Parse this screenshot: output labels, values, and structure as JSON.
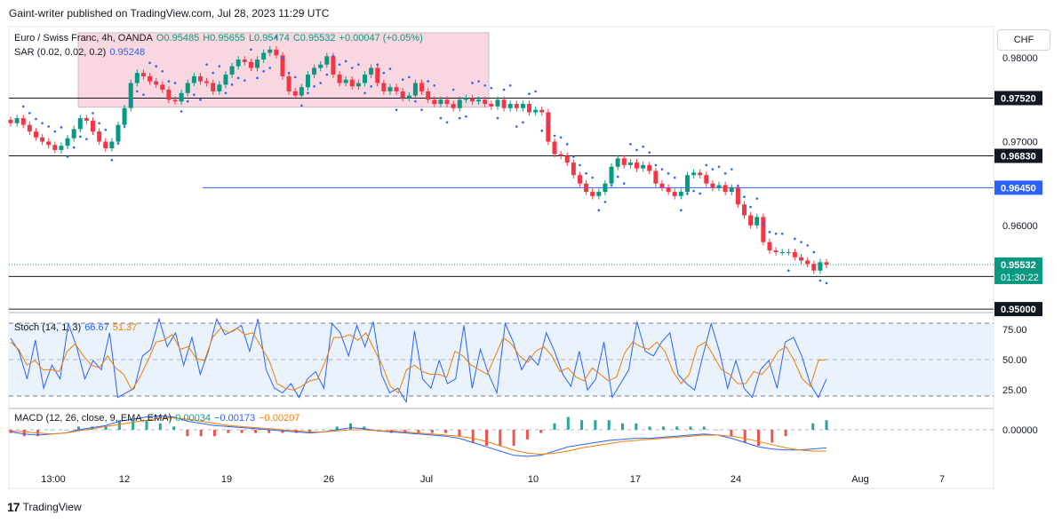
{
  "header": {
    "publisher_line": "Gaint-writer published on TradingView.com, Jul 28, 2023 11:29 UTC"
  },
  "main_legend": {
    "symbol": "Euro / Swiss Franc, 4h, OANDA",
    "open": "O0.95485",
    "high": "H0.95655",
    "low": "L0.95474",
    "close": "C0.95532",
    "change": "+0.00047 (+0.05%)"
  },
  "sar_legend": {
    "label": "SAR (0.02, 0.02, 0.2)",
    "value": "0.95248"
  },
  "stoch_legend": {
    "label": "Stoch (14, 1, 3)",
    "k": "66.67",
    "d": "51.37"
  },
  "macd_legend": {
    "label": "MACD (12, 26, close, 9, EMA, EMA)",
    "hist": "0.00034",
    "macd": "−0.00173",
    "signal": "−0.00207"
  },
  "currency_button": "CHF",
  "footer": {
    "brand": "TradingView",
    "logo": "17"
  },
  "colors": {
    "up": "#089981",
    "down": "#f23645",
    "sar": "#2962ff",
    "stoch_k": "#2962ff",
    "stoch_d": "#f57c00",
    "zone": "#f8d7e0",
    "hline_blue": "#2962ff"
  },
  "chart_data": {
    "type": "candlestick",
    "price_axis": {
      "ticks": [
        "0.98000",
        "0.97000",
        "0.96000"
      ],
      "range": [
        0.9498,
        0.9832
      ]
    },
    "x_axis_labels": [
      "13:00",
      "12",
      "19",
      "26",
      "Jul",
      "10",
      "17",
      "24",
      "Aug",
      "7"
    ],
    "levels": [
      {
        "label": "0.97520",
        "value": 0.9752,
        "style": "black"
      },
      {
        "label": "0.96830",
        "value": 0.9683,
        "style": "black"
      },
      {
        "label": "0.96450",
        "value": 0.9645,
        "style": "blue"
      },
      {
        "label": "0.95390",
        "value": 0.9539,
        "style": "black"
      },
      {
        "label": "0.95000",
        "value": 0.95,
        "style": "black"
      }
    ],
    "current_price": {
      "label": "0.95532",
      "value": 0.95532,
      "countdown": "01:30:22"
    },
    "zone": {
      "top": 0.983,
      "bottom": 0.9741
    },
    "closes": [
      0.9722,
      0.9728,
      0.972,
      0.9712,
      0.9705,
      0.97,
      0.9696,
      0.969,
      0.9695,
      0.9704,
      0.9715,
      0.9728,
      0.9725,
      0.9712,
      0.97,
      0.9692,
      0.97,
      0.972,
      0.974,
      0.977,
      0.9782,
      0.9778,
      0.9772,
      0.9768,
      0.9762,
      0.975,
      0.9748,
      0.9758,
      0.977,
      0.9778,
      0.9772,
      0.977,
      0.976,
      0.9768,
      0.978,
      0.979,
      0.9798,
      0.9795,
      0.9788,
      0.9798,
      0.9806,
      0.981,
      0.9803,
      0.9778,
      0.976,
      0.9755,
      0.9765,
      0.978,
      0.9788,
      0.9792,
      0.9802,
      0.978,
      0.977,
      0.9774,
      0.9766,
      0.977,
      0.978,
      0.9788,
      0.977,
      0.976,
      0.9765,
      0.976,
      0.9752,
      0.9755,
      0.977,
      0.976,
      0.975,
      0.9745,
      0.975,
      0.9745,
      0.974,
      0.975,
      0.9752,
      0.9748,
      0.975,
      0.9745,
      0.9742,
      0.975,
      0.974,
      0.9745,
      0.974,
      0.9745,
      0.9735,
      0.9738,
      0.9735,
      0.97,
      0.9685,
      0.9683,
      0.9675,
      0.966,
      0.965,
      0.964,
      0.9635,
      0.964,
      0.965,
      0.967,
      0.968,
      0.9672,
      0.9675,
      0.9668,
      0.9672,
      0.9665,
      0.965,
      0.9645,
      0.964,
      0.9635,
      0.964,
      0.966,
      0.9663,
      0.966,
      0.965,
      0.9645,
      0.9648,
      0.964,
      0.9645,
      0.9625,
      0.9612,
      0.96,
      0.961,
      0.958,
      0.957,
      0.9568,
      0.9568,
      0.9568,
      0.9562,
      0.9558,
      0.9554,
      0.9546,
      0.9556,
      0.9553
    ],
    "stoch_k": [
      74,
      60,
      30,
      72,
      20,
      45,
      30,
      90,
      65,
      30,
      50,
      40,
      80,
      10,
      15,
      20,
      55,
      62,
      95,
      65,
      80,
      45,
      75,
      35,
      60,
      95,
      78,
      82,
      88,
      60,
      95,
      40,
      20,
      15,
      25,
      10,
      30,
      38,
      20,
      90,
      80,
      55,
      88,
      65,
      92,
      35,
      15,
      20,
      5,
      82,
      30,
      20,
      50,
      25,
      30,
      88,
      20,
      62,
      35,
      15,
      90,
      70,
      40,
      55,
      45,
      80,
      60,
      35,
      22,
      60,
      18,
      30,
      70,
      10,
      25,
      40,
      92,
      60,
      55,
      70,
      80,
      35,
      25,
      18,
      55,
      90,
      60,
      20,
      50,
      20,
      10,
      40,
      50,
      20,
      70,
      75,
      55,
      25,
      10,
      30
    ],
    "stoch_d": [
      70,
      62,
      45,
      50,
      40,
      40,
      38,
      60,
      68,
      55,
      45,
      42,
      55,
      42,
      35,
      18,
      32,
      50,
      70,
      72,
      78,
      62,
      65,
      52,
      50,
      75,
      85,
      80,
      85,
      78,
      80,
      65,
      50,
      25,
      20,
      18,
      22,
      28,
      30,
      50,
      75,
      75,
      78,
      72,
      80,
      62,
      45,
      22,
      15,
      40,
      45,
      38,
      35,
      35,
      32,
      60,
      55,
      45,
      40,
      35,
      55,
      75,
      68,
      55,
      48,
      60,
      65,
      55,
      38,
      42,
      32,
      28,
      42,
      35,
      28,
      32,
      58,
      70,
      65,
      62,
      70,
      60,
      38,
      25,
      35,
      65,
      70,
      55,
      40,
      35,
      25,
      25,
      38,
      35,
      45,
      60,
      65,
      50,
      30,
      22,
      50,
      51
    ],
    "macd": [
      -0.0002,
      -0.0004,
      -0.0005,
      -0.0004,
      -0.0003,
      0.0,
      0.0002,
      0.0004,
      0.0008,
      0.001,
      0.0012,
      0.0013,
      0.0012,
      0.0008,
      0.0006,
      0.0004,
      0.0003,
      0.0002,
      0.0001,
      0.0,
      -0.0001,
      -0.0002,
      -0.0003,
      -0.0002,
      0.0,
      0.0002,
      0.0001,
      -0.0001,
      -0.0002,
      -0.0003,
      -0.0004,
      -0.0005,
      -0.0006,
      -0.0008,
      -0.0012,
      -0.0016,
      -0.002,
      -0.0024,
      -0.0025,
      -0.0024,
      -0.002,
      -0.0016,
      -0.0014,
      -0.0012,
      -0.001,
      -0.0009,
      -0.0008,
      -0.0008,
      -0.0007,
      -0.0006,
      -0.0005,
      -0.0004,
      -0.0005,
      -0.0008,
      -0.0012,
      -0.0016,
      -0.0018,
      -0.0019,
      -0.0019,
      -0.0018,
      -0.0017
    ],
    "macd_signal": [
      -0.0001,
      -0.0002,
      -0.0003,
      -0.0004,
      -0.0003,
      -0.0001,
      0.0001,
      0.0003,
      0.0005,
      0.0007,
      0.0009,
      0.0011,
      0.0011,
      0.001,
      0.0008,
      0.0006,
      0.0004,
      0.0003,
      0.0002,
      0.0001,
      0.0,
      -0.0001,
      -0.0002,
      -0.0002,
      -0.0001,
      0.0,
      0.0,
      -0.0001,
      -0.0001,
      -0.0002,
      -0.0003,
      -0.0004,
      -0.0005,
      -0.0006,
      -0.0008,
      -0.0011,
      -0.0015,
      -0.0019,
      -0.0022,
      -0.0023,
      -0.0022,
      -0.002,
      -0.0017,
      -0.0015,
      -0.0013,
      -0.0011,
      -0.001,
      -0.0009,
      -0.0008,
      -0.0007,
      -0.0006,
      -0.0005,
      -0.0005,
      -0.0006,
      -0.0008,
      -0.0011,
      -0.0014,
      -0.0017,
      -0.0019,
      -0.002,
      -0.002
    ],
    "macd_axis_label": "0.00000",
    "stoch_axis_ticks": [
      "75.00",
      "50.00",
      "25.00"
    ]
  }
}
